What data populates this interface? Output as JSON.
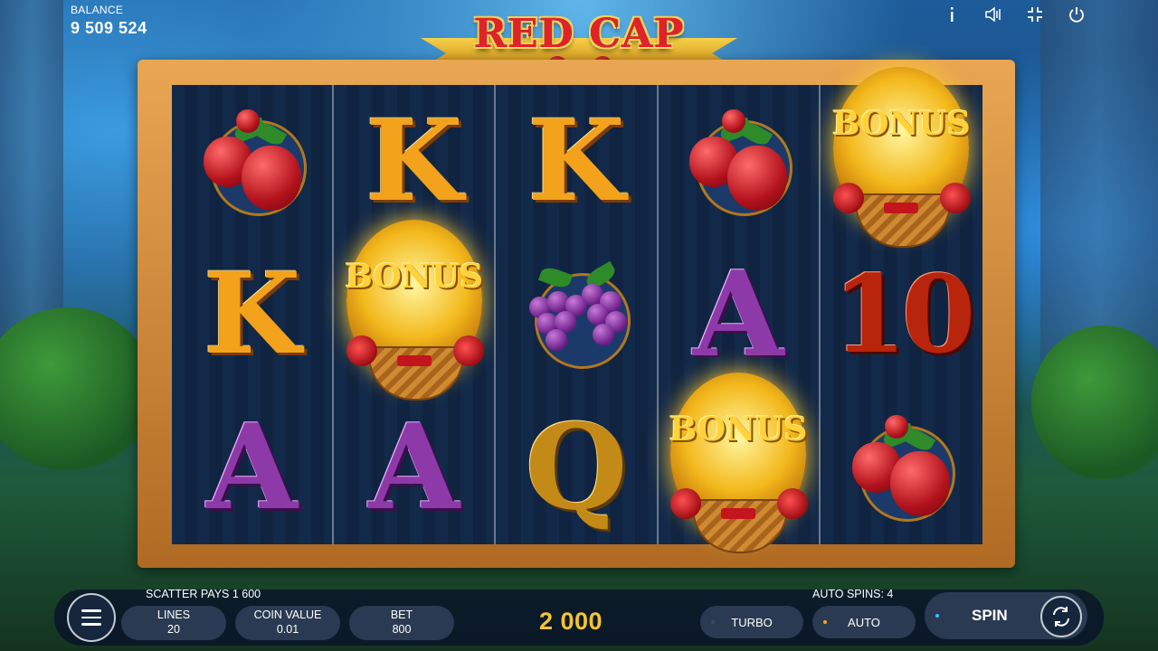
{
  "balance": {
    "label": "BALANCE",
    "value": "9 509 524"
  },
  "top_icons": [
    "info-icon",
    "sound-icon",
    "fullscreen-icon",
    "power-icon"
  ],
  "logo": {
    "text": "RED CAP"
  },
  "reels": [
    [
      "strawberry",
      "K",
      "A"
    ],
    [
      "K",
      "BONUS",
      "A"
    ],
    [
      "K",
      "grapes",
      "Q"
    ],
    [
      "strawberry",
      "A",
      "BONUS"
    ],
    [
      "BONUS",
      "10",
      "strawberry"
    ]
  ],
  "symbols": {
    "k": "K",
    "a": "A",
    "q": "Q",
    "ten": "10",
    "bonus": "BONUS"
  },
  "info": {
    "scatter": "SCATTER PAYS 1 600",
    "auto_spins": "AUTO SPINS: 4"
  },
  "lines": {
    "label": "LINES",
    "value": "20"
  },
  "coin_value": {
    "label": "COIN VALUE",
    "value": "0.01"
  },
  "bet": {
    "label": "BET",
    "value": "800"
  },
  "win": "2 000",
  "turbo": "TURBO",
  "auto": "AUTO",
  "spin": "SPIN",
  "colors": {
    "win": "#f5c52a",
    "auto_dot": "#f5a623",
    "spin_dot": "#2ec7ff",
    "turbo_dot": "#3a4a60"
  }
}
